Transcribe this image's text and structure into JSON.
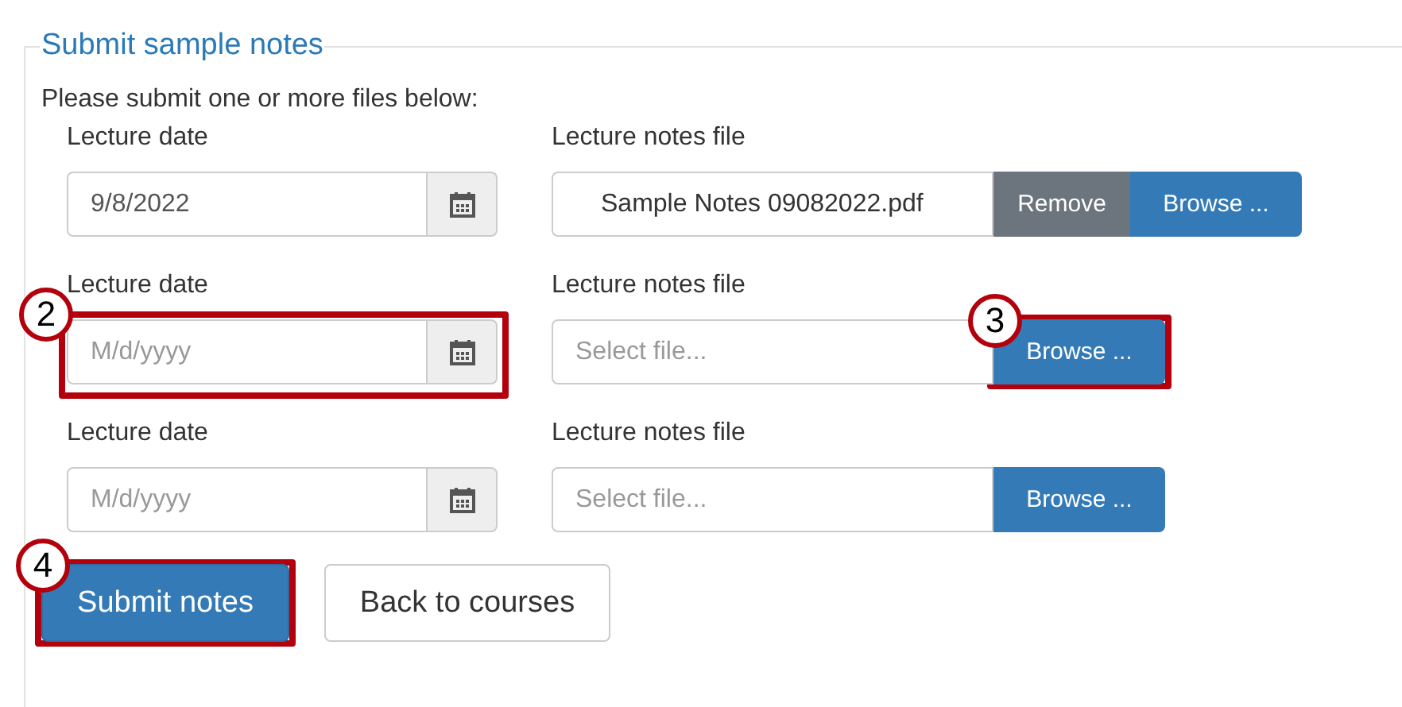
{
  "legend": "Submit sample notes",
  "instructions": "Please submit one or more files below:",
  "rows": [
    {
      "date_label": "Lecture date",
      "date": {
        "value": "9/8/2022"
      },
      "file_label": "Lecture notes file",
      "file": {
        "value": "Sample Notes 09082022.pdf"
      },
      "remove_button": "Remove",
      "browse_button": "Browse ..."
    },
    {
      "date_label": "Lecture date",
      "date": {
        "placeholder": "M/d/yyyy",
        "callout": "2"
      },
      "file_label": "Lecture notes file",
      "file": {
        "placeholder": "Select file..."
      },
      "browse_button": "Browse ...",
      "browse_callout": "3"
    },
    {
      "date_label": "Lecture date",
      "date": {
        "placeholder": "M/d/yyyy"
      },
      "file_label": "Lecture notes file",
      "file": {
        "placeholder": "Select file..."
      },
      "browse_button": "Browse ..."
    }
  ],
  "buttons": [
    {
      "label": "Submit notes",
      "kind": "primary",
      "callout": "4"
    },
    {
      "label": "Back to courses",
      "kind": "default"
    }
  ]
}
